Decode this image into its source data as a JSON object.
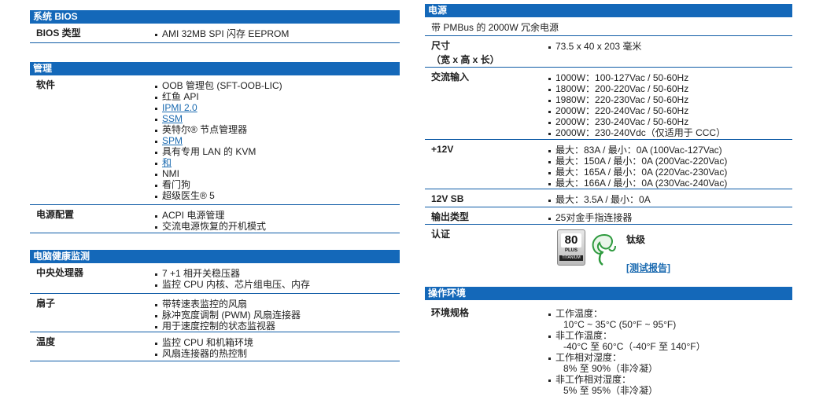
{
  "left": {
    "bios": {
      "header": "系统 BIOS",
      "rows": [
        {
          "label": "BIOS 类型",
          "values": [
            "AMI 32MB SPI 闪存 EEPROM"
          ]
        }
      ]
    },
    "management": {
      "header": "管理",
      "software": {
        "label": "软件",
        "values": [
          {
            "text": "OOB 管理包 (SFT-OOB-LIC)",
            "link": false
          },
          {
            "text": "红鱼 API",
            "link": false
          },
          {
            "text": "IPMI 2.0",
            "link": true
          },
          {
            "text": "SSM",
            "link": true
          },
          {
            "text": "英特尔® 节点管理器",
            "link": false
          },
          {
            "text": "SPM",
            "link": true
          },
          {
            "text": "具有专用 LAN 的 KVM",
            "link": false
          },
          {
            "text": "和",
            "link": true
          },
          {
            "text": "NMI",
            "link": false
          },
          {
            "text": "看门狗",
            "link": false
          },
          {
            "text": "超级医生® 5",
            "link": false
          }
        ]
      },
      "power_config": {
        "label": "电源配置",
        "values": [
          "ACPI 电源管理",
          "交流电源恢复的开机模式"
        ]
      }
    },
    "health": {
      "header": "电脑健康监测",
      "cpu": {
        "label": "中央处理器",
        "values": [
          "7 +1 相开关稳压器",
          "监控 CPU 内核、芯片组电压、内存"
        ]
      },
      "fan": {
        "label": "扇子",
        "values": [
          "带转速表监控的风扇",
          "脉冲宽度调制 (PWM) 风扇连接器",
          "用于速度控制的状态监视器"
        ]
      },
      "temp": {
        "label": "温度",
        "values": [
          "监控 CPU 和机箱环境",
          "风扇连接器的热控制"
        ]
      }
    }
  },
  "right": {
    "power": {
      "header": "电源",
      "description": "带 PMBus 的 2000W 冗余电源",
      "size": {
        "label_line1": "尺寸",
        "label_line2": "（宽 x 高 x 长）",
        "values": [
          "73.5 x 40 x 203 毫米"
        ]
      },
      "ac_input": {
        "label": "交流输入",
        "values": [
          "1000W：100-127Vac / 50-60Hz",
          "1800W：200-220Vac / 50-60Hz",
          "1980W：220-230Vac / 50-60Hz",
          "2000W：220-240Vac / 50-60Hz",
          "2000W：230-240Vac / 50-60Hz",
          "2000W：230-240Vdc（仅适用于 CCC）"
        ]
      },
      "plus12v": {
        "label": "+12V",
        "values": [
          "最大：83A / 最小：0A (100Vac-127Vac)",
          "最大：150A / 最小：0A (200Vac-220Vac)",
          "最大：165A / 最小：0A (220Vac-230Vac)",
          "最大：166A / 最小：0A (230Vac-240Vac)"
        ]
      },
      "sb12v": {
        "label": "12V SB",
        "values": [
          "最大：3.5A / 最小：0A"
        ]
      },
      "output": {
        "label": "输出类型",
        "values": [
          "25对金手指连接器"
        ]
      },
      "cert": {
        "label": "认证",
        "badge_number": "80",
        "badge_plus": "PLUS",
        "badge_level": "TITANIUM",
        "level_text": "钛级",
        "report_link": "[测试报告]",
        "badge_icon": "80-plus-titanium-icon",
        "leaf_icon": "green-leaf-icon"
      }
    },
    "environment": {
      "header": "操作环境",
      "spec": {
        "label": "环境规格",
        "items": [
          {
            "title": "工作温度：",
            "value": "10°C ~ 35°C (50°F ~ 95°F)"
          },
          {
            "title": "非工作温度：",
            "value": "-40°C 至 60°C（-40°F 至 140°F）"
          },
          {
            "title": "工作相对湿度：",
            "value": "8% 至 90%（非冷凝）"
          },
          {
            "title": "非工作相对湿度：",
            "value": "5% 至 95%（非冷凝）"
          }
        ]
      }
    }
  },
  "colors": {
    "header_bg": "#1468b9",
    "divider": "#0e5ba6",
    "link": "#1a6ab0"
  }
}
